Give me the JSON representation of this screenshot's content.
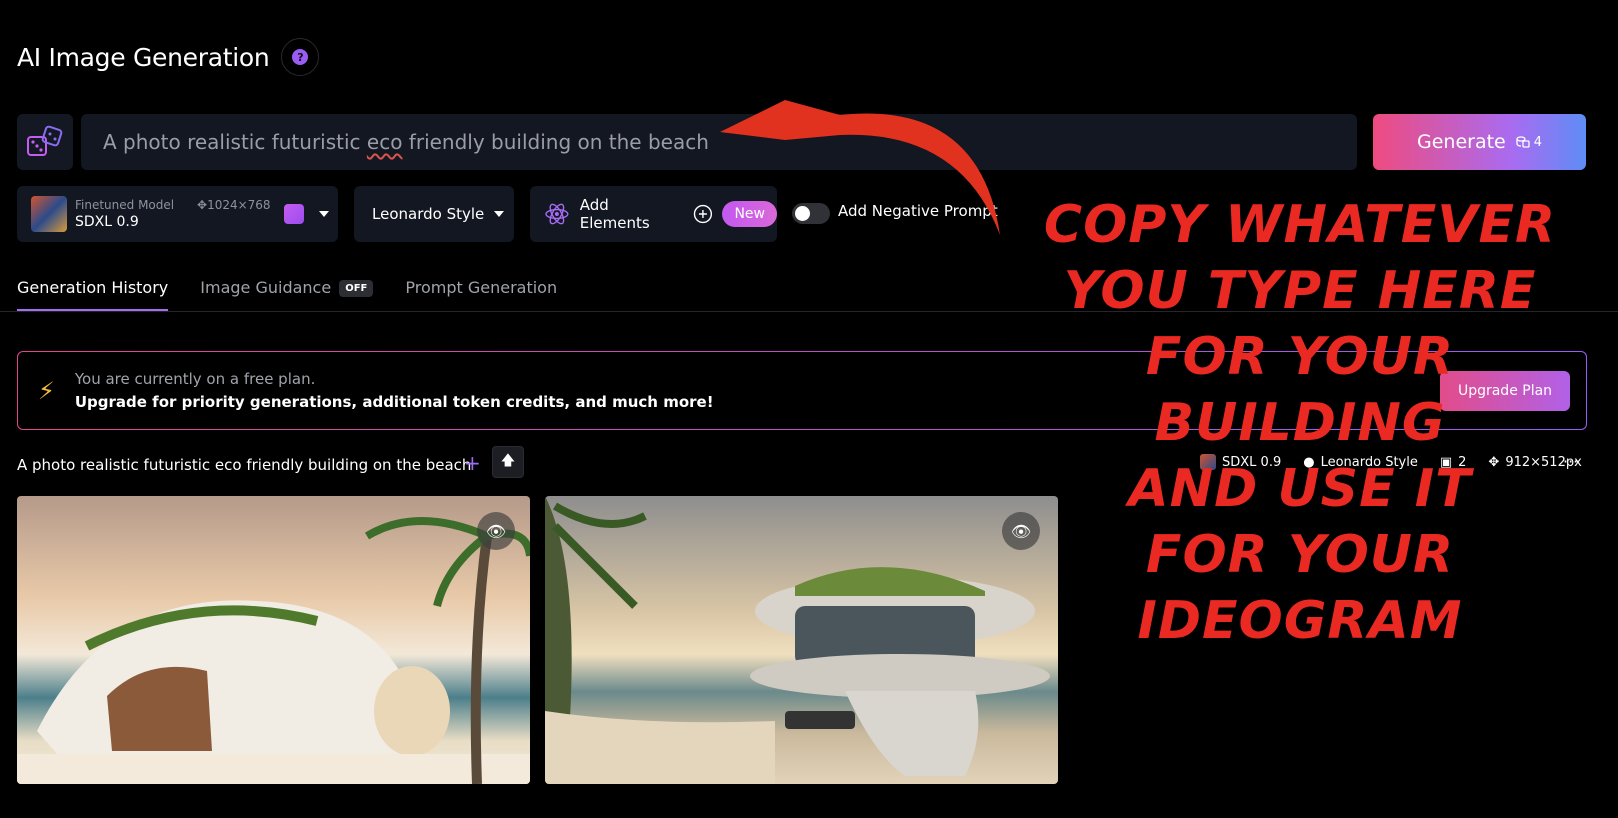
{
  "header": {
    "title": "AI Image Generation",
    "help_icon": "question-circle-icon"
  },
  "prompt": {
    "value_before": "A photo realistic futuristic ",
    "value_misspelled": "eco",
    "value_after": " friendly building on the beach",
    "random_icon": "dice-icon"
  },
  "generate": {
    "label": "Generate",
    "tokens": "4"
  },
  "model": {
    "kind": "Finetuned Model",
    "name": "SDXL 0.9",
    "dimensions": "1024×768"
  },
  "style": {
    "label": "Leonardo Style"
  },
  "elements": {
    "label": "Add Elements",
    "badge": "New"
  },
  "negative_prompt": {
    "label": "Add Negative Prompt",
    "enabled": false
  },
  "tabs": [
    {
      "label": "Generation History",
      "active": true
    },
    {
      "label": "Image Guidance",
      "badge": "OFF"
    },
    {
      "label": "Prompt Generation"
    }
  ],
  "upgrade": {
    "line1": "You are currently on a free plan.",
    "line2": "Upgrade for priority generations, additional token credits, and much more!",
    "button": "Upgrade Plan"
  },
  "history": {
    "prompt": "A photo realistic futuristic eco friendly building on the beach",
    "meta": {
      "model": "SDXL 0.9",
      "style": "Leonardo Style",
      "count": "2",
      "size": "912×512px"
    }
  },
  "annotation": {
    "lines": [
      "Copy whatever",
      "you type here",
      "for your",
      "building",
      "and use it",
      "for your",
      "ideogram"
    ],
    "color": "#ea2a22"
  }
}
